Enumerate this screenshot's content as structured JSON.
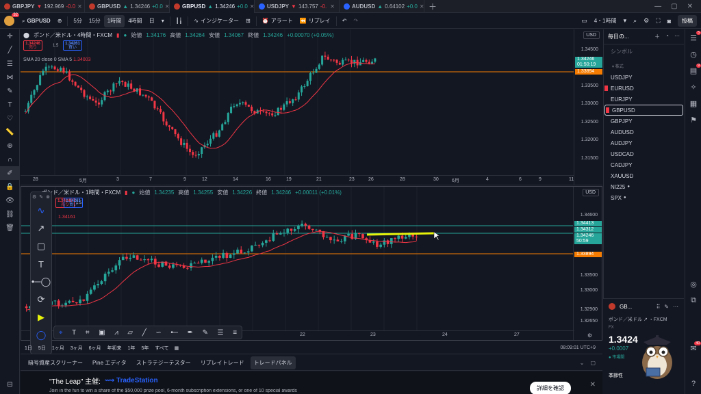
{
  "tabs": [
    {
      "symbol": "GBPJPY",
      "arrow": "▼",
      "price": "192.969",
      "change": "-0.0",
      "dir": "down",
      "color": "#c0392b"
    },
    {
      "symbol": "GBPUSD",
      "arrow": "▲",
      "price": "1.34246",
      "change": "+0.0",
      "dir": "up",
      "color": "#c0392b"
    },
    {
      "symbol": "GBPUSD",
      "arrow": "▲",
      "price": "1.34246",
      "change": "+0.0",
      "dir": "up",
      "color": "#c0392b",
      "active": true
    },
    {
      "symbol": "USDJPY",
      "arrow": "▼",
      "price": "143.757",
      "change": "-0.",
      "dir": "down",
      "color": "#2962ff"
    },
    {
      "symbol": "AUDUSD",
      "arrow": "▲",
      "price": "0.64102",
      "change": "+0.0",
      "dir": "up",
      "color": "#2962ff"
    }
  ],
  "toolbar": {
    "avatar_badge": "32",
    "symbol": "GBPUSD",
    "intervals": [
      "5分",
      "15分",
      "1時間",
      "4時間",
      "日"
    ],
    "selected_interval": "1時間",
    "indicators": "インジケーター",
    "alert": "アラート",
    "replay": "リプレイ",
    "layout_label": "4・1時間",
    "post": "投稿"
  },
  "pane1": {
    "title": "ポンド／米ドル・4時間・FXCM",
    "ohlc": {
      "open_label": "始値",
      "open": "1.34176",
      "high_label": "高値",
      "high": "1.34264",
      "low_label": "安値",
      "low": "1.34067",
      "close_label": "終値",
      "close": "1.34246",
      "change": "+0.00070 (+0.05%)"
    },
    "sell_price": "1.34246",
    "sell_label": "売り",
    "spread": "1.5",
    "buy_price": "1.34261",
    "buy_label": "買い",
    "sma_label": "SMA 20 close 0 SMA 5",
    "sma_value": "1.34003",
    "currency": "USD",
    "price_ticks": [
      "1.34500",
      "1.34000",
      "1.33500",
      "1.33000",
      "1.32500",
      "1.32000",
      "1.31500"
    ],
    "price_label": "1.34246",
    "countdown": "01:50:19",
    "level_label": "1.33894",
    "time_ticks": [
      "28",
      "5月",
      "3",
      "7",
      "9",
      "12",
      "14",
      "16",
      "19",
      "21",
      "23",
      "26",
      "28",
      "30",
      "6月",
      "4",
      "6",
      "9",
      "11"
    ]
  },
  "pane2": {
    "title": "ポンド／米ドル・1時間・FXCM",
    "ohlc": {
      "open_label": "始値",
      "open": "1.34235",
      "high_label": "高値",
      "high": "1.34255",
      "low_label": "安値",
      "low": "1.34226",
      "close_label": "終値",
      "close": "1.34246",
      "change": "+0.00011 (+0.01%)"
    },
    "sell_price": "1.34246",
    "sell_label": "売り",
    "spread": "1.5",
    "buy_price": "1.34261",
    "buy_label": "買い",
    "sma_value": "1.34161",
    "currency": "USD",
    "price_ticks": [
      "1.34600",
      "1.34000",
      "1.33500",
      "1.33000",
      "1.32900",
      "1.32650"
    ],
    "label_upper": "1.34413",
    "label_mid": "1.34312",
    "price_label": "1.34246",
    "countdown": "50:59",
    "level_label": "1.33894",
    "time_ticks": [
      "22",
      "23",
      "24",
      "27"
    ]
  },
  "rangebar": {
    "items": [
      "1日",
      "5日",
      "1ヶ月",
      "3ヶ月",
      "6ヶ月",
      "年初来",
      "1年",
      "5年",
      "すべて"
    ],
    "clock": "08:09:01 UTC+9"
  },
  "bottom_tabs": [
    "暗号資産スクリーナー",
    "Pine エディタ",
    "ストラテジーテスター",
    "リプレイトレード",
    "トレードパネル"
  ],
  "bottom_tab_active": "トレードパネル",
  "ad": {
    "headline": "\"The Leap\" 主催:",
    "brand": "TradeStation",
    "sub": "Join in the fun to win a share of the $50,000 prize pool, 6-month subscription extensions, or one of 10 special awards",
    "cta": "詳細を確認"
  },
  "watchlist": {
    "title": "毎日の...",
    "column": "シンボル",
    "section": "株式",
    "items": [
      {
        "symbol": "USDJPY"
      },
      {
        "symbol": "EURUSD",
        "flag": true
      },
      {
        "symbol": "EURJPY"
      },
      {
        "symbol": "GBPUSD",
        "flag": true,
        "selected": true
      },
      {
        "symbol": "GBPJPY"
      },
      {
        "symbol": "AUDUSD"
      },
      {
        "symbol": "AUDJPY"
      },
      {
        "symbol": "USDCAD"
      },
      {
        "symbol": "CADJPY"
      },
      {
        "symbol": "XAUUSD"
      },
      {
        "symbol": "NI225",
        "dot": true
      },
      {
        "symbol": "SPX",
        "dot": true
      }
    ]
  },
  "detail": {
    "symbol": "GB...",
    "name": "ポンド／米ドル",
    "exchange": "FXCM",
    "type": "FX",
    "price": "1.3424",
    "change": "+0.0007",
    "market": "市場開",
    "season": "季節性"
  },
  "rail_badges": [
    "5",
    "9",
    "40"
  ],
  "colors": {
    "up": "#26a69a",
    "down": "#f23645",
    "sma": "#f23645",
    "level": "#f57c00",
    "highlight": "#e6f20a",
    "accent": "#2962ff"
  }
}
